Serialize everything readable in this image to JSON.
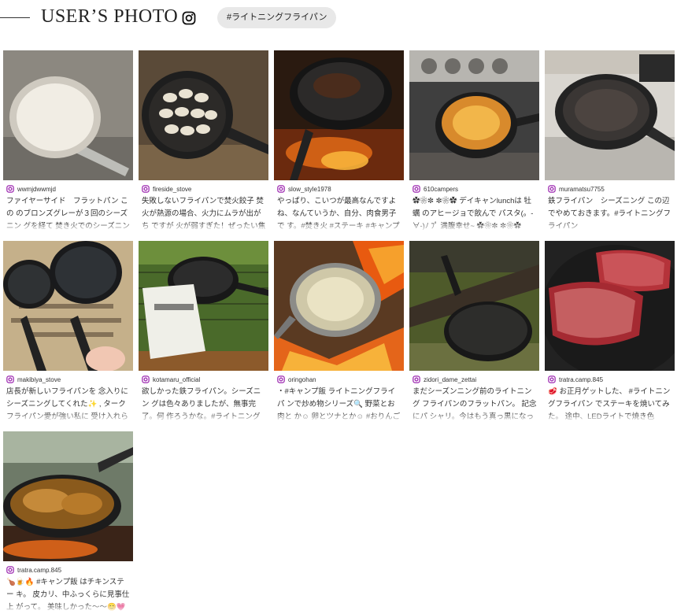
{
  "header": {
    "title": "USER’S PHOTO",
    "tag": "#ライトニングフライパン"
  },
  "posts": [
    {
      "user": "wwmjdwwmjd",
      "caption": "ファイヤーサイド　フラットパン この のブロンズグレーが３回のシーズニン グを経て 焚き火でのシーズニング、"
    },
    {
      "user": "fireside_stove",
      "caption": "失敗しないフライパンで焚火餃子 焚 火が熱源の場合、火力にムラが出がち ですが 火が弱すぎた！ぜったい焦げ"
    },
    {
      "user": "slow_style1978",
      "caption": "やっぱり、こいつが最高なんですよ ね、なんていうか、自分、肉食男子で す。#焚き火 #ステーキ #キャンプ飯 #"
    },
    {
      "user": "610campers",
      "caption": "✿❀✼ ✼❀✿ デイキャンlunchは 牡蠣 のアヒージョで飲んで パスタ(。-∀-)ﾉ ﾌﾟ 満腹幸せ~ ✿❀✼ ✼❀✿ ✿❀✼"
    },
    {
      "user": "muramatsu7755",
      "caption": "鉄フライパン　シーズニング この辺 でやめておきます。#ライトニングフ ライパン"
    },
    {
      "user": "makibiya_stove",
      "caption": "店長が新しいフライパンを 念入りに シーズニングしてくれた✨ , ターク フライパン愛が強い私に 受け入れら"
    },
    {
      "user": "kotamaru_official",
      "caption": "欲しかった鉄フライパン。シーズニン グは色々ありましたが、無事完了。何 作ろうかな。#ライトニングフライパ"
    },
    {
      "user": "oringohan",
      "caption": "・#キャンプ飯 ライトニングフライパ ンで炒め物シリーズ🔍 野菜とお肉と か☺ 卵とツナとか☺ #おりんごはん #"
    },
    {
      "user": "zidori_dame_zettai",
      "caption": "まだシーズンニング前のライトニング フライパンのフラットパン。 記念にパ シャリ。今はもう真っ黒になっていい"
    },
    {
      "user": "tratra.camp.845",
      "caption": "🥩 お正月ゲットした、 #ライトニン グフライパン でステーキを焼いてみ た。 途中、LEDライトで焼き色"
    },
    {
      "user": "tratra.camp.845",
      "caption": "🍗🍺🔥 #キャンプ飯 はチキンステー キ。 皮カリ、中ふっくらに見事仕上 がって。 美味しかった〜〜😊💗🔥"
    }
  ],
  "colors": {
    "tag_bg": "#e8e8e8",
    "instagram_icon": "#9c27b0",
    "pan_iron": "#2b2b2b"
  }
}
